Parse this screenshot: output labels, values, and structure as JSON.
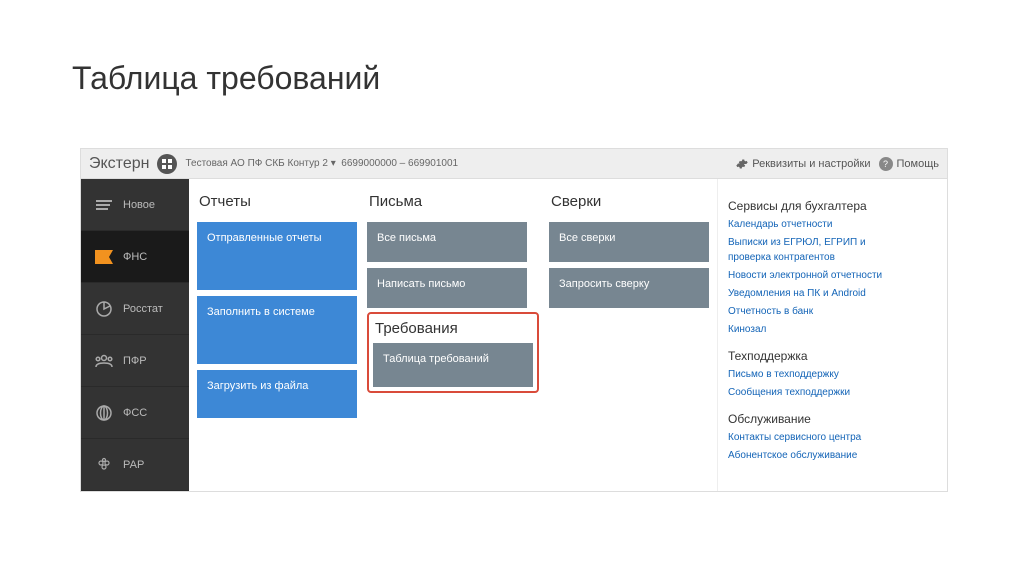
{
  "page_title": "Таблица требований",
  "topbar": {
    "app_name": "Экстерн",
    "org_name": "Тестовая АО ПФ СКБ Контур 2",
    "org_codes": "6699000000 – 669901001",
    "settings_label": "Реквизиты и настройки",
    "help_label": "Помощь"
  },
  "sidebar": {
    "items": [
      "Новое",
      "ФНС",
      "Росстат",
      "ПФР",
      "ФСС",
      "РАР"
    ]
  },
  "columns": {
    "reports": {
      "title": "Отчеты",
      "items": [
        "Отправленные отчеты",
        "Заполнить в системе",
        "Загрузить из файла"
      ]
    },
    "letters": {
      "title": "Письма",
      "items": [
        "Все письма",
        "Написать письмо"
      ]
    },
    "requirements": {
      "title": "Требования",
      "items": [
        "Таблица требований"
      ]
    },
    "reconciliation": {
      "title": "Сверки",
      "items": [
        "Все сверки",
        "Запросить сверку"
      ]
    }
  },
  "right_panel": {
    "sections": [
      {
        "title": "Сервисы для бухгалтера",
        "links": [
          "Календарь отчетности",
          "Выписки из ЕГРЮЛ, ЕГРИП и проверка контрагентов",
          "Новости электронной отчетности",
          "Уведомления на ПК и Android",
          "Отчетность в банк",
          "Кинозал"
        ]
      },
      {
        "title": "Техподдержка",
        "links": [
          "Письмо в техподдержку",
          "Сообщения техподдержки"
        ]
      },
      {
        "title": "Обслуживание",
        "links": [
          "Контакты сервисного центра",
          "Абонентское обслуживание"
        ]
      }
    ]
  }
}
